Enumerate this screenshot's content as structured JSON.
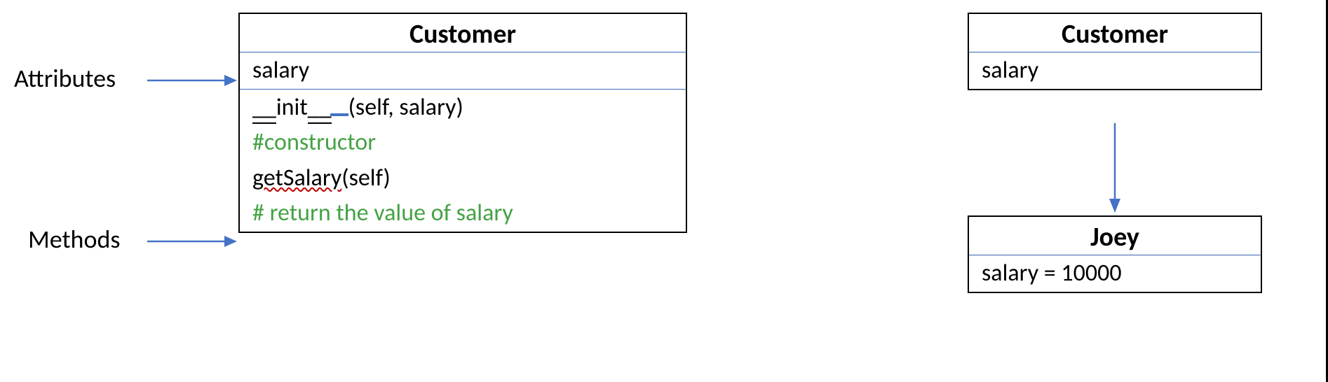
{
  "labels": {
    "attributes": "Attributes",
    "methods": "Methods"
  },
  "classBox": {
    "title": "Customer",
    "attribute": "salary",
    "init_prefix_us": "__",
    "init_text": "init",
    "init_suffix_us": "__",
    "init_params": "(self, salary)",
    "constructor_comment": "#constructor",
    "method_name": "getSalary",
    "method_params": "(self)",
    "method_comment": "# return the value of salary"
  },
  "instance": {
    "class_title": "Customer",
    "class_attr": "salary",
    "obj_title": "Joey",
    "obj_value": "salary = 10000"
  }
}
